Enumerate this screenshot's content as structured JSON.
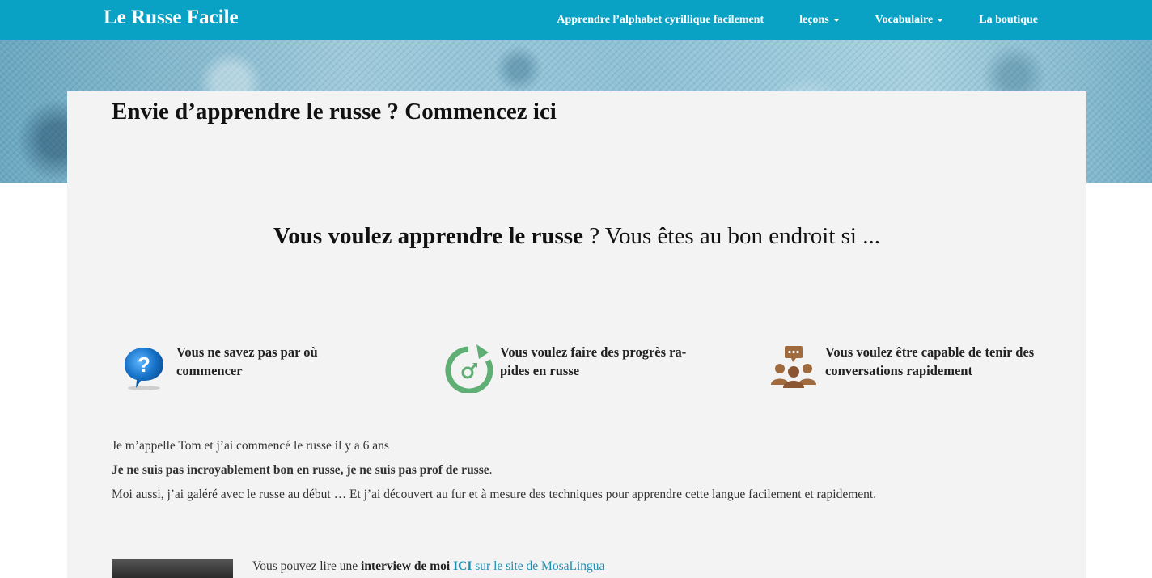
{
  "navbar": {
    "brand": "Le Russe Facile",
    "items": [
      {
        "label": "Apprendre l’alphabet cyrillique facilement",
        "has_caret": false
      },
      {
        "label": "leçons",
        "has_caret": true
      },
      {
        "label": "Vocabulaire",
        "has_caret": true
      },
      {
        "label": "La boutique",
        "has_caret": false
      }
    ],
    "color": "#0aa2c4"
  },
  "main": {
    "title": "Envie d’apprendre le russe ? Commencez ici",
    "lead_bold": "Vous voulez apprendre le russe",
    "lead_rest": " ? Vous êtes au bon endroit si ...",
    "features": [
      {
        "icon": "question-bubble-icon",
        "text": "Vous ne savez pas par où commencer"
      },
      {
        "icon": "progress-arrow-icon",
        "text": "Vous voulez faire des progrès ra-pides en russe"
      },
      {
        "icon": "conversation-people-icon",
        "text": "Vous voulez être capable de tenir des conversations rapidement"
      }
    ],
    "para1": "Je m’appelle Tom et j’ai commencé le russe il y a 6 ans",
    "para2": "Je ne suis pas incroyablement bon en russe, je ne suis pas prof de russe",
    "para2_end": ".",
    "para3": "Moi aussi, j’ai galéré avec le russe au début … Et j’ai découvert au fur et à mesure des techniques pour apprendre cette langue facilement et rapidement.",
    "interview_pre": "Vous pouvez lire une ",
    "interview_bold": "interview de moi",
    "interview_space": " ",
    "interview_link_bold": "ICI",
    "interview_link_rest": " sur le site de MosaLingua"
  }
}
